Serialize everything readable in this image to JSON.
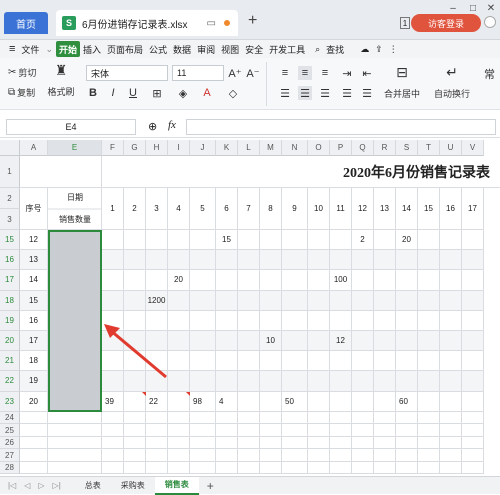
{
  "window": {
    "home_tab": "首页",
    "file_tab": "6月份进销存记录表.xlsx",
    "new_tab_symbol": "+",
    "login_button": "访客登录",
    "page_badge": "1"
  },
  "menu": {
    "file": "文件",
    "items": [
      "开始",
      "插入",
      "页面布局",
      "公式",
      "数据",
      "审阅",
      "视图",
      "安全",
      "开发工具"
    ],
    "search": "查找"
  },
  "toolbar": {
    "cut": "剪切",
    "copy": "复制",
    "format_painter": "格式刷",
    "font_name": "宋体",
    "font_size": "11",
    "merge_center": "合并居中",
    "auto_wrap": "自动换行",
    "common": "常"
  },
  "formula_bar": {
    "name_box": "E4",
    "fx": "fx"
  },
  "sheet": {
    "columns": [
      "A",
      "E",
      "F",
      "G",
      "H",
      "I",
      "J",
      "K",
      "L",
      "M",
      "N",
      "O",
      "P",
      "Q",
      "R",
      "S",
      "T",
      "U",
      "V"
    ],
    "title": "2020年6月份销售记录表",
    "header_seq": "序号",
    "header_date": "日期",
    "header_qty": "销售数量",
    "day_numbers": [
      "1",
      "2",
      "3",
      "4",
      "5",
      "6",
      "7",
      "8",
      "9",
      "10",
      "11",
      "12",
      "13",
      "14",
      "15",
      "16",
      "17"
    ],
    "rows": [
      {
        "row": "15",
        "seq": "12",
        "vals": {
          "K": "15",
          "Q": "2",
          "S": "20"
        }
      },
      {
        "row": "16",
        "seq": "13",
        "vals": {}
      },
      {
        "row": "17",
        "seq": "14",
        "vals": {
          "I": "20",
          "P": "100"
        }
      },
      {
        "row": "18",
        "seq": "15",
        "vals": {
          "H": "1200"
        }
      },
      {
        "row": "19",
        "seq": "16",
        "vals": {}
      },
      {
        "row": "20",
        "seq": "17",
        "vals": {
          "M": "10",
          "P": "12"
        }
      },
      {
        "row": "21",
        "seq": "18",
        "vals": {}
      },
      {
        "row": "22",
        "seq": "19",
        "vals": {}
      },
      {
        "row": "23",
        "seq": "20",
        "vals": {
          "F": "39",
          "H": "22",
          "J": "98",
          "K": "4",
          "N": "50",
          "S": "60"
        }
      }
    ],
    "empty_rows": [
      "24",
      "25",
      "26",
      "27",
      "28"
    ],
    "header_row_numbers": [
      "1",
      "2",
      "3"
    ]
  },
  "sheet_tabs": [
    "总表",
    "采购表",
    "销售表"
  ],
  "active_sheet": "销售表",
  "colors": {
    "accent_green": "#2c8a3c",
    "arrow_red": "#e03b2f",
    "selection_fill": "#c9ccd1"
  }
}
